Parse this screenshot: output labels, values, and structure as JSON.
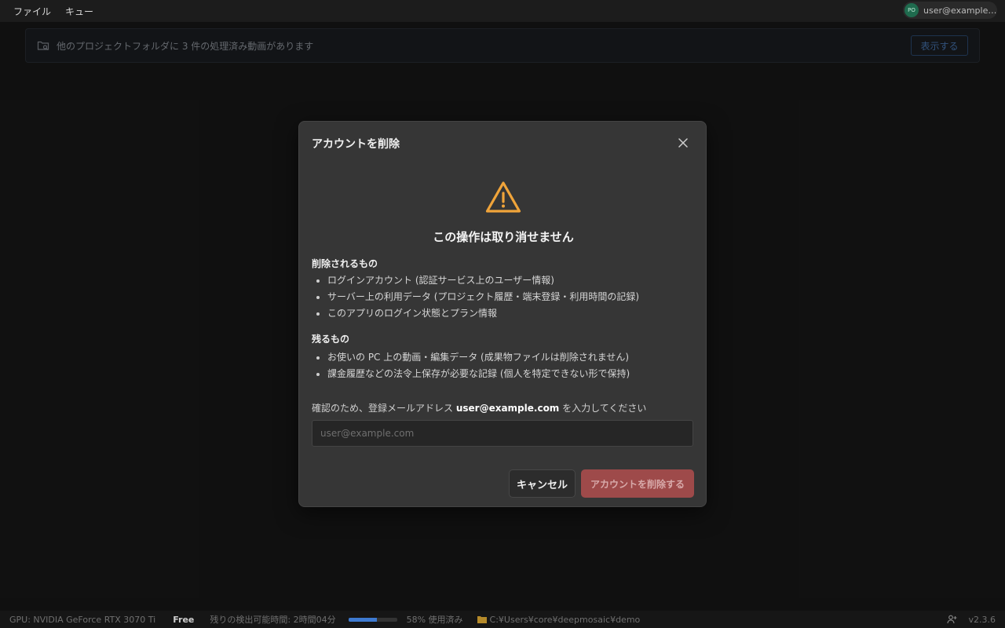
{
  "menu": {
    "items": [
      "ファイル",
      "キュー"
    ]
  },
  "user": {
    "initials": "PO",
    "email": "user@example.com"
  },
  "banner": {
    "text": "他のプロジェクトフォルダに 3 件の処理済み動画があります",
    "button_label": "表示する"
  },
  "dialog": {
    "title": "アカウントを削除",
    "warning_heading": "この操作は取り消せません",
    "deleted_title": "削除されるもの",
    "deleted_items": [
      "ログインアカウント (認証サービス上のユーザー情報)",
      "サーバー上の利用データ (プロジェクト履歴・端末登録・利用時間の記録)",
      "このアプリのログイン状態とプラン情報"
    ],
    "kept_title": "残るもの",
    "kept_items": [
      "お使いの PC 上の動画・編集データ (成果物ファイルは削除されません)",
      "課金履歴などの法令上保存が必要な記録 (個人を特定できない形で保持)"
    ],
    "confirm_prefix": "確認のため、登録メールアドレス ",
    "confirm_email": "user@example.com",
    "confirm_suffix": " を入力してください",
    "input_placeholder": "user@example.com",
    "input_value": "",
    "cancel_label": "キャンセル",
    "delete_label": "アカウントを削除する",
    "colors": {
      "warning": "#f0a43a",
      "danger": "#9e4a4a"
    }
  },
  "statusbar": {
    "gpu": "GPU: NVIDIA GeForce RTX 3070 Ti",
    "plan": "Free",
    "remaining_time": "残りの検出可能時間: 2時間04分",
    "usage_fraction": 0.58,
    "usage_label": "58% 使用済み",
    "folder_path": "C:¥Users¥core¥deepmosaic¥demo",
    "version": "v2.3.6",
    "accent_color": "#3e7ad1"
  }
}
